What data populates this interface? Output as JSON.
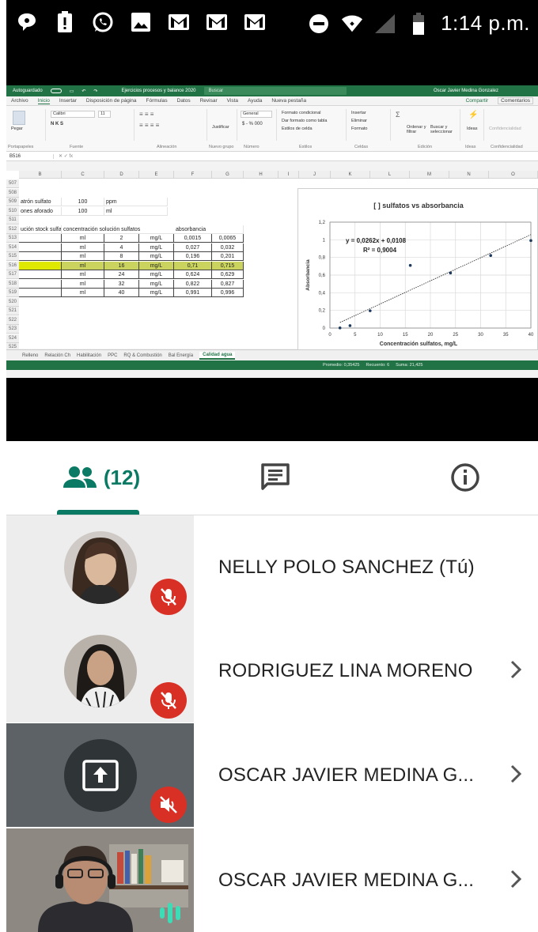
{
  "status_bar": {
    "time": "1:14 p.m.",
    "left_icons": [
      "message-icon",
      "alert-icon",
      "whatsapp-icon",
      "image-icon",
      "gmail-icon",
      "gmail-icon",
      "gmail-icon"
    ],
    "right_icons": [
      "do-not-disturb-icon",
      "wifi-icon",
      "signal-icon",
      "battery-icon"
    ]
  },
  "excel": {
    "autosave": "Autoguardado",
    "file_title": "Ejercicios procesos y balance 2020",
    "search": "Buscar",
    "user": "Oscar Javier Medina Gonzalez",
    "tabs": [
      "Archivo",
      "Inicio",
      "Insertar",
      "Disposición de página",
      "Fórmulas",
      "Datos",
      "Revisar",
      "Vista",
      "Ayuda",
      "Nueva pestaña"
    ],
    "share": "Compartir",
    "comments": "Comentarios",
    "ribbon_groups": [
      "Portapapeles",
      "Fuente",
      "Alineación",
      "Nuevo grupo",
      "Número",
      "Estilos",
      "Celdas",
      "Edición",
      "Ideas",
      "Confidencialidad"
    ],
    "ribbon_labels": {
      "paste": "Pegar",
      "font": "Calibri",
      "size": "11",
      "justify": "Justificar",
      "number_format": "General",
      "cond_format": "Formato condicional",
      "table_format": "Dar formato como tabla",
      "cell_styles": "Estilos de celda",
      "insert": "Insertar",
      "delete": "Eliminar",
      "format": "Formato",
      "sort": "Ordenar y filtrar",
      "find": "Buscar y seleccionar",
      "ideas": "Ideas",
      "sensitivity": "Confidencialidad"
    },
    "name_box": "B516",
    "columns": [
      "B",
      "C",
      "D",
      "E",
      "F",
      "G",
      "H",
      "I",
      "J",
      "K",
      "L",
      "M",
      "N",
      "O"
    ],
    "rows": [
      {
        "n": "507",
        "cells": []
      },
      {
        "n": "508",
        "cells": []
      },
      {
        "n": "509",
        "cells": [
          "atrón sulfato",
          "100",
          "ppm"
        ]
      },
      {
        "n": "510",
        "cells": [
          "ones aforado",
          "100",
          "ml"
        ]
      },
      {
        "n": "511",
        "cells": []
      },
      {
        "n": "512",
        "cells": [
          "ución stock sulfatos",
          "concentración solución sulfatos",
          "absorbancia"
        ]
      },
      {
        "n": "513",
        "cells": [
          "",
          "ml",
          "2",
          "mg/L",
          "0,0015",
          "0,0065"
        ]
      },
      {
        "n": "514",
        "cells": [
          "",
          "ml",
          "4",
          "mg/L",
          "0,027",
          "0,032"
        ]
      },
      {
        "n": "515",
        "cells": [
          "",
          "ml",
          "8",
          "mg/L",
          "0,196",
          "0,201"
        ]
      },
      {
        "n": "516",
        "cells": [
          "",
          "ml",
          "16",
          "mg/L",
          "0,71",
          "0,715"
        ]
      },
      {
        "n": "517",
        "cells": [
          "",
          "ml",
          "24",
          "mg/L",
          "0,624",
          "0,629"
        ]
      },
      {
        "n": "518",
        "cells": [
          "",
          "ml",
          "32",
          "mg/L",
          "0,822",
          "0,827"
        ]
      },
      {
        "n": "519",
        "cells": [
          "",
          "ml",
          "40",
          "mg/L",
          "0,991",
          "0,996"
        ]
      },
      {
        "n": "520",
        "cells": []
      },
      {
        "n": "521",
        "cells": []
      },
      {
        "n": "522",
        "cells": []
      },
      {
        "n": "523",
        "cells": []
      },
      {
        "n": "524",
        "cells": []
      },
      {
        "n": "525",
        "cells": []
      }
    ],
    "sheets": [
      "Relleno",
      "Relación Ch",
      "Habilitación",
      "PPC",
      "RQ & Combustión",
      "Bal Energía",
      "Calidad agua"
    ],
    "active_sheet": "Calidad agua",
    "status": {
      "average": "Promedio: 0,35425",
      "count": "Recuento: 6",
      "sum": "Suma: 21,425"
    }
  },
  "chart_data": {
    "type": "scatter",
    "title": "[ ] sulfatos vs absorbancia",
    "xlabel": "Concentración sulfatos, mg/L",
    "ylabel": "Absorbancia",
    "xlim": [
      0,
      40
    ],
    "ylim": [
      0,
      1.2
    ],
    "x_ticks": [
      "0",
      "5",
      "10",
      "15",
      "20",
      "25",
      "30",
      "35",
      "40"
    ],
    "y_ticks": [
      "0",
      "0,2",
      "0,4",
      "0,6",
      "0,8",
      "1",
      "1,2"
    ],
    "points": [
      [
        2,
        0.0015
      ],
      [
        4,
        0.027
      ],
      [
        8,
        0.196
      ],
      [
        16,
        0.71
      ],
      [
        24,
        0.624
      ],
      [
        32,
        0.822
      ],
      [
        40,
        0.991
      ]
    ],
    "trendline": {
      "slope": 0.0262,
      "intercept": 0.0108,
      "equation": "y = 0,0262x + 0,0108",
      "r2": "R² = 0,9004"
    },
    "grid": true
  },
  "tabs": {
    "people_count": "(12)",
    "people_icon": "people-icon",
    "chat_icon": "chat-icon",
    "info_icon": "info-icon"
  },
  "participants": [
    {
      "name": "NELLY POLO SANCHEZ (Tú)",
      "muted": true
    },
    {
      "name": "RODRIGUEZ LINA MORENO",
      "muted": true
    },
    {
      "name": "OSCAR JAVIER MEDINA G...",
      "presenting": true,
      "volume_off": true
    },
    {
      "name": "OSCAR JAVIER MEDINA G...",
      "speaking": true
    }
  ],
  "colors": {
    "accent": "#0b7a65",
    "mute": "#d93025",
    "excel_green": "#217346",
    "highlight": "#dfe800"
  }
}
